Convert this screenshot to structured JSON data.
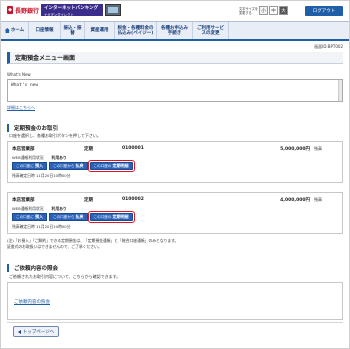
{
  "header": {
    "bank_name": "長野銀行",
    "ib_title": "インターネットバンキング",
    "ib_subtitle": "ナガギンダイレクト",
    "font_size_label": "文字サイズを\n変更する",
    "font_small": "小",
    "font_mid": "中",
    "font_large": "大",
    "logout": "ログアウト"
  },
  "nav": {
    "home": "ホーム",
    "items": [
      "口座情報",
      "振込・振替",
      "資産運用",
      "税金・各種料金の払込み(ペイジー)",
      "各種お申込み手続き",
      "ご利用サービスの変更"
    ]
  },
  "screen_id": "画面ID:BPT002",
  "page_title": "定期預金メニュー画面",
  "whats_new": {
    "label": "What's New",
    "content": "What's new",
    "detail_link": "詳細はこちらへ"
  },
  "section_accounts": {
    "heading": "定期預金のお取引",
    "instruction": "口座を選択し、各種お取引ボタンを押して下さい。",
    "accounts": [
      {
        "branch": "本店営業部",
        "type": "定期",
        "number": "0100001",
        "balance": "5,000,000円",
        "balance_label": "残高",
        "web_status_label": "WEB通帳利用状況",
        "web_status_value": "利用あり",
        "buttons": [
          {
            "prefix": "この口座に",
            "action": "預入"
          },
          {
            "prefix": "この口座から",
            "action": "払戻"
          },
          {
            "prefix": "この口座の",
            "action": "定期明細"
          }
        ],
        "confirmed_date": "残高確定日時 11月20日10時00分"
      },
      {
        "branch": "本店営業部",
        "type": "定期",
        "number": "0100002",
        "balance": "4,000,000円",
        "balance_label": "残高",
        "web_status_label": "WEB通帳利用状況",
        "web_status_value": "利用あり",
        "buttons": [
          {
            "prefix": "この口座に",
            "action": "預入"
          },
          {
            "prefix": "この口座から",
            "action": "払戻"
          },
          {
            "prefix": "この口座の",
            "action": "定期明細"
          }
        ],
        "confirmed_date": "残高確定日時 11月20日10時00分"
      }
    ]
  },
  "note": {
    "line1": "(注)「お預入」「ご解約」できる定期預金は、「定期預金通帳」と「総合口座通帳」のみとなります。",
    "line2": "証書式のお取扱いはできませんので、ご了承ください。"
  },
  "section_inquiry": {
    "heading": "ご依頼内容の照会",
    "description": "ご依頼されたお取引内容について、こちらから確認できます。",
    "link": "ご依頼内容の照会"
  },
  "top_button": "トップページへ"
}
